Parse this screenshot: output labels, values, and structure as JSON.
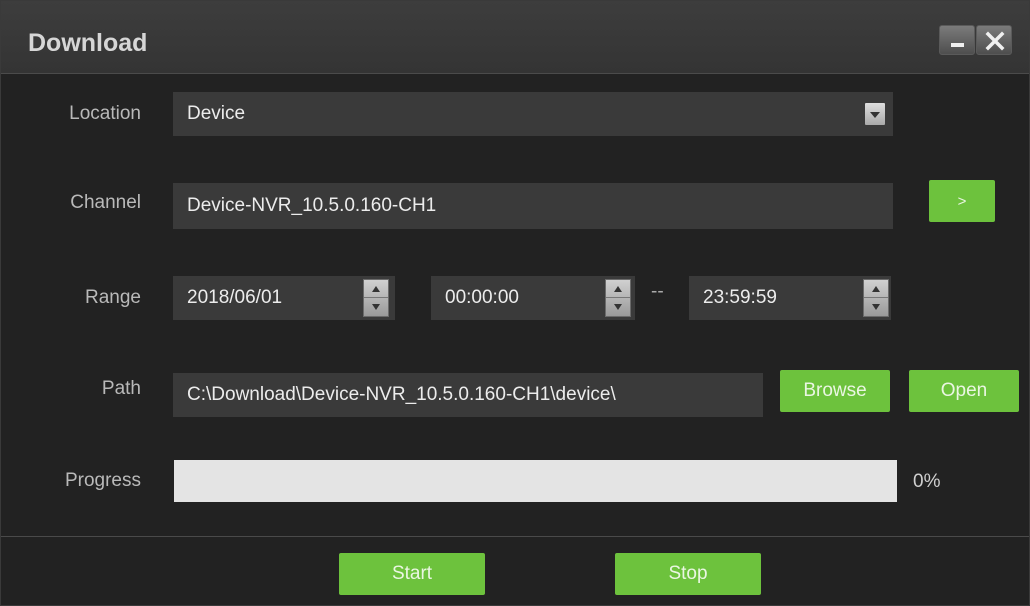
{
  "window": {
    "title": "Download",
    "minimize_icon": "minimize-icon",
    "close_icon": "close-icon"
  },
  "location": {
    "label": "Location",
    "value": "Device",
    "icon": "chevron-down-icon"
  },
  "channel": {
    "label": "Channel",
    "value": "Device-NVR_10.5.0.160-CH1",
    "select_button": ">"
  },
  "range": {
    "label": "Range",
    "date": "2018/06/01",
    "start_time": "00:00:00",
    "separator": "--",
    "end_time": "23:59:59"
  },
  "path": {
    "label": "Path",
    "value": "C:\\Download\\Device-NVR_10.5.0.160-CH1\\device\\",
    "browse_label": "Browse",
    "open_label": "Open"
  },
  "progress": {
    "label": "Progress",
    "percent_text": "0%",
    "fraction": 0
  },
  "actions": {
    "start_label": "Start",
    "stop_label": "Stop"
  },
  "colors": {
    "accent_green": "#6dc23d",
    "panel_bg": "#222222",
    "field_bg": "#3a3a3a"
  }
}
